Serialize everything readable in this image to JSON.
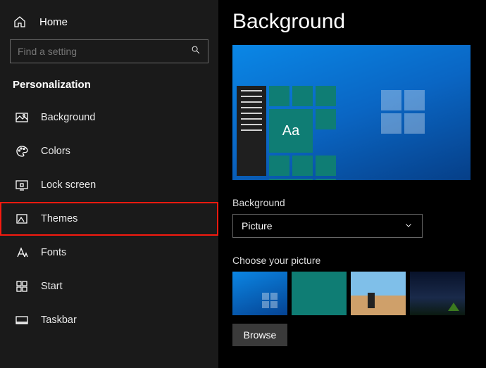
{
  "sidebar": {
    "home_label": "Home",
    "search_placeholder": "Find a setting",
    "section_title": "Personalization",
    "items": [
      {
        "label": "Background"
      },
      {
        "label": "Colors"
      },
      {
        "label": "Lock screen"
      },
      {
        "label": "Themes"
      },
      {
        "label": "Fonts"
      },
      {
        "label": "Start"
      },
      {
        "label": "Taskbar"
      }
    ]
  },
  "main": {
    "title": "Background",
    "preview_tile_text": "Aa",
    "bg_label": "Background",
    "bg_dropdown_value": "Picture",
    "choose_label": "Choose your picture",
    "browse_label": "Browse"
  },
  "highlight_index": 3
}
